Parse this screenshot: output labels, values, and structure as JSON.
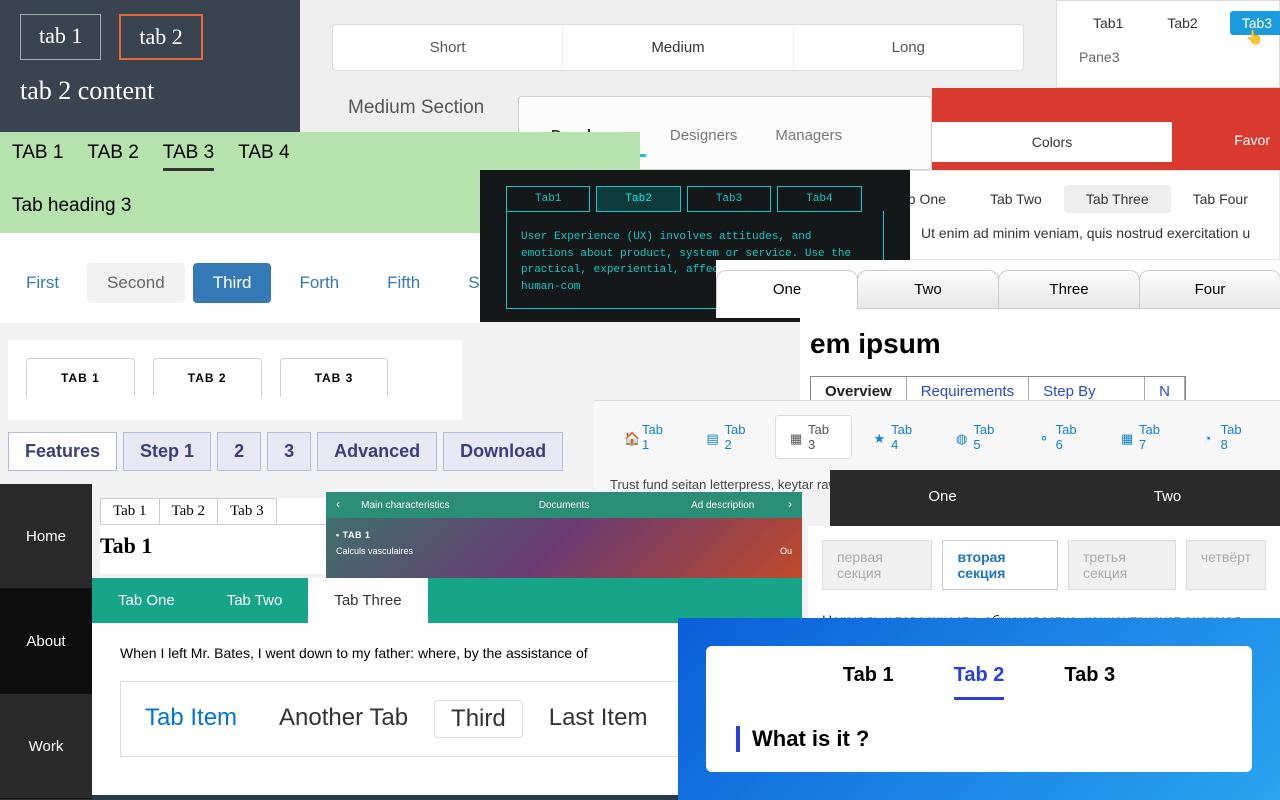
{
  "A": {
    "tabs": [
      "tab 1",
      "tab 2"
    ],
    "active": 1,
    "content": "tab 2 content"
  },
  "B": {
    "tabs": [
      "Short",
      "Medium",
      "Long"
    ],
    "active": 1,
    "heading": "Medium Section"
  },
  "C": {
    "tabs": [
      "Tab1",
      "Tab2",
      "Tab3"
    ],
    "active": 2,
    "pane": "Pane3"
  },
  "D": {
    "tabs": [
      "Developers",
      "Designers",
      "Managers"
    ],
    "active": 0
  },
  "E": {
    "left": "Colors",
    "right": "Favor"
  },
  "F": {
    "tabs": [
      "TAB 1",
      "TAB 2",
      "TAB 3",
      "TAB 4"
    ],
    "active": 2,
    "heading": "Tab heading 3"
  },
  "G": {
    "tabs": [
      "Tab One",
      "Tab Two",
      "Tab Three",
      "Tab Four"
    ],
    "active": 2,
    "text": "Ut enim ad minim veniam, quis nostrud exercitation u"
  },
  "H": {
    "tabs": [
      "First",
      "Second",
      "Third",
      "Forth",
      "Fifth",
      "Sixth"
    ],
    "soft": 1,
    "active": 2
  },
  "I": {
    "tabs": [
      "Tab1",
      "Tab2",
      "Tab3",
      "Tab4"
    ],
    "active": 1,
    "text": "User Experience (UX) involves attitudes, and emotions about product, system or service. Use the practical, experiential, affec valuable aspects of human-com"
  },
  "J": {
    "tabs": [
      "One",
      "Two",
      "Three",
      "Four"
    ],
    "active": 0
  },
  "K": {
    "tabs": [
      "TAB 1",
      "TAB 2",
      "TAB 3"
    ]
  },
  "L": {
    "title": "em ipsum",
    "tabs": [
      "Overview",
      "Requirements",
      "Step By Step",
      "N"
    ],
    "active": 0
  },
  "M": {
    "tabs": [
      "Tab 1",
      "Tab 2",
      "Tab 3",
      "Tab 4",
      "Tab 5",
      "Tab 6",
      "Tab 7",
      "Tab 8"
    ],
    "icons": [
      "home",
      "file",
      "calendar",
      "star",
      "globe",
      "share",
      "grid",
      "pie"
    ],
    "active": 2,
    "text": "Trust fund seitan letterpress, keytar raw cosby sweater. Fanny pack portland se"
  },
  "N": {
    "tabs": [
      "Features",
      "Step 1",
      "2",
      "3",
      "Advanced",
      "Download"
    ],
    "active": 0
  },
  "O": {
    "tabs": [
      "Tab 1",
      "Tab 2",
      "Tab 3"
    ],
    "heading": "Tab 1"
  },
  "P": {
    "items": [
      "Home",
      "About",
      "Work"
    ],
    "active": 1
  },
  "Q": {
    "tabs": [
      "Main characteristics",
      "Documents",
      "Ad description"
    ],
    "sub": "• TAB 1",
    "row_label": "Calculs vasculaires",
    "row_val": "Ou"
  },
  "R": {
    "tabs": [
      "One",
      "Two"
    ]
  },
  "S": {
    "tabs": [
      "первая секция",
      "вторая секция",
      "третья секция",
      "четвёрт"
    ],
    "active": 1,
    "text": "Нормаль к поверхности, общеизвестно, концентрирует анормал"
  },
  "T": {
    "tabs": [
      "Tab One",
      "Tab Two",
      "Tab Three"
    ],
    "active": 2,
    "line": "When I left Mr. Bates, I went down to my father: where, by the assistance of ",
    "inner": [
      "Tab Item",
      "Another Tab",
      "Third",
      "Last Item"
    ],
    "inner_active": 2
  },
  "U": {
    "tabs": [
      "Tab 1",
      "Tab 2",
      "Tab 3"
    ],
    "active": 1,
    "heading": "What is it ?"
  }
}
